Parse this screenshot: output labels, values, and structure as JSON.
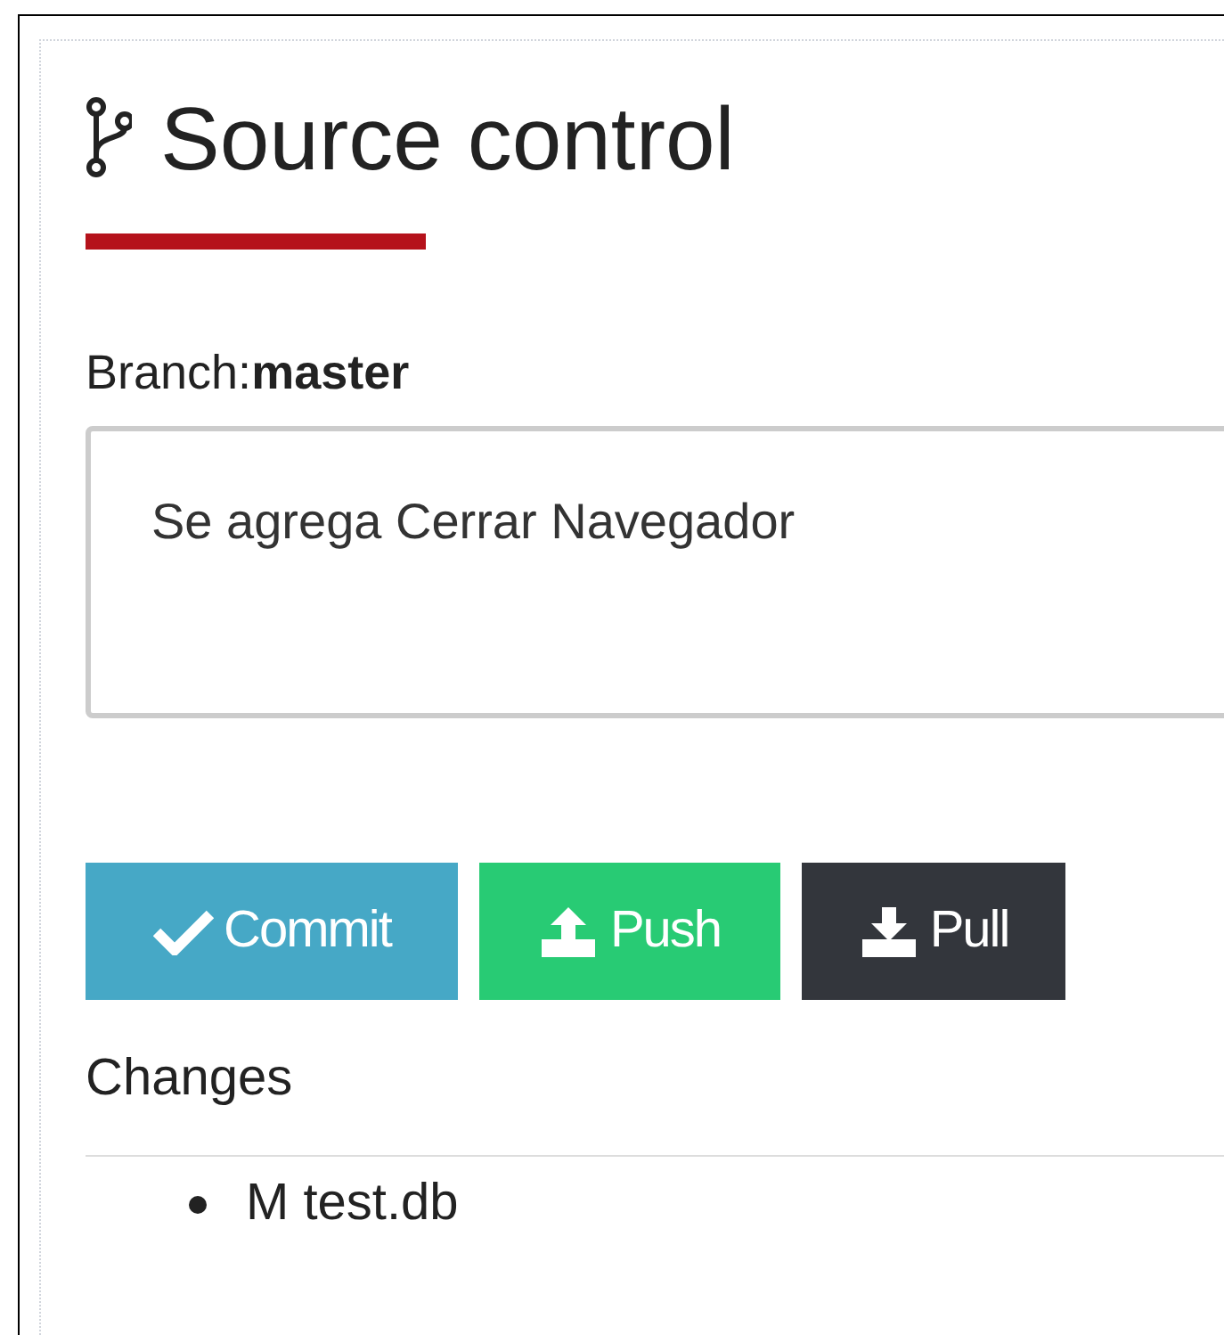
{
  "panel": {
    "title": "Source control",
    "branch_label": "Branch:",
    "branch": "master",
    "commit_message": {
      "value": "Se agrega Cerrar Navegador"
    },
    "buttons": [
      {
        "kind": "commit",
        "label": "Commit"
      },
      {
        "kind": "push",
        "label": "Push"
      },
      {
        "kind": "pull",
        "label": "Pull"
      }
    ],
    "changes_heading": "Changes",
    "changes": [
      {
        "text": "M test.db"
      }
    ]
  }
}
